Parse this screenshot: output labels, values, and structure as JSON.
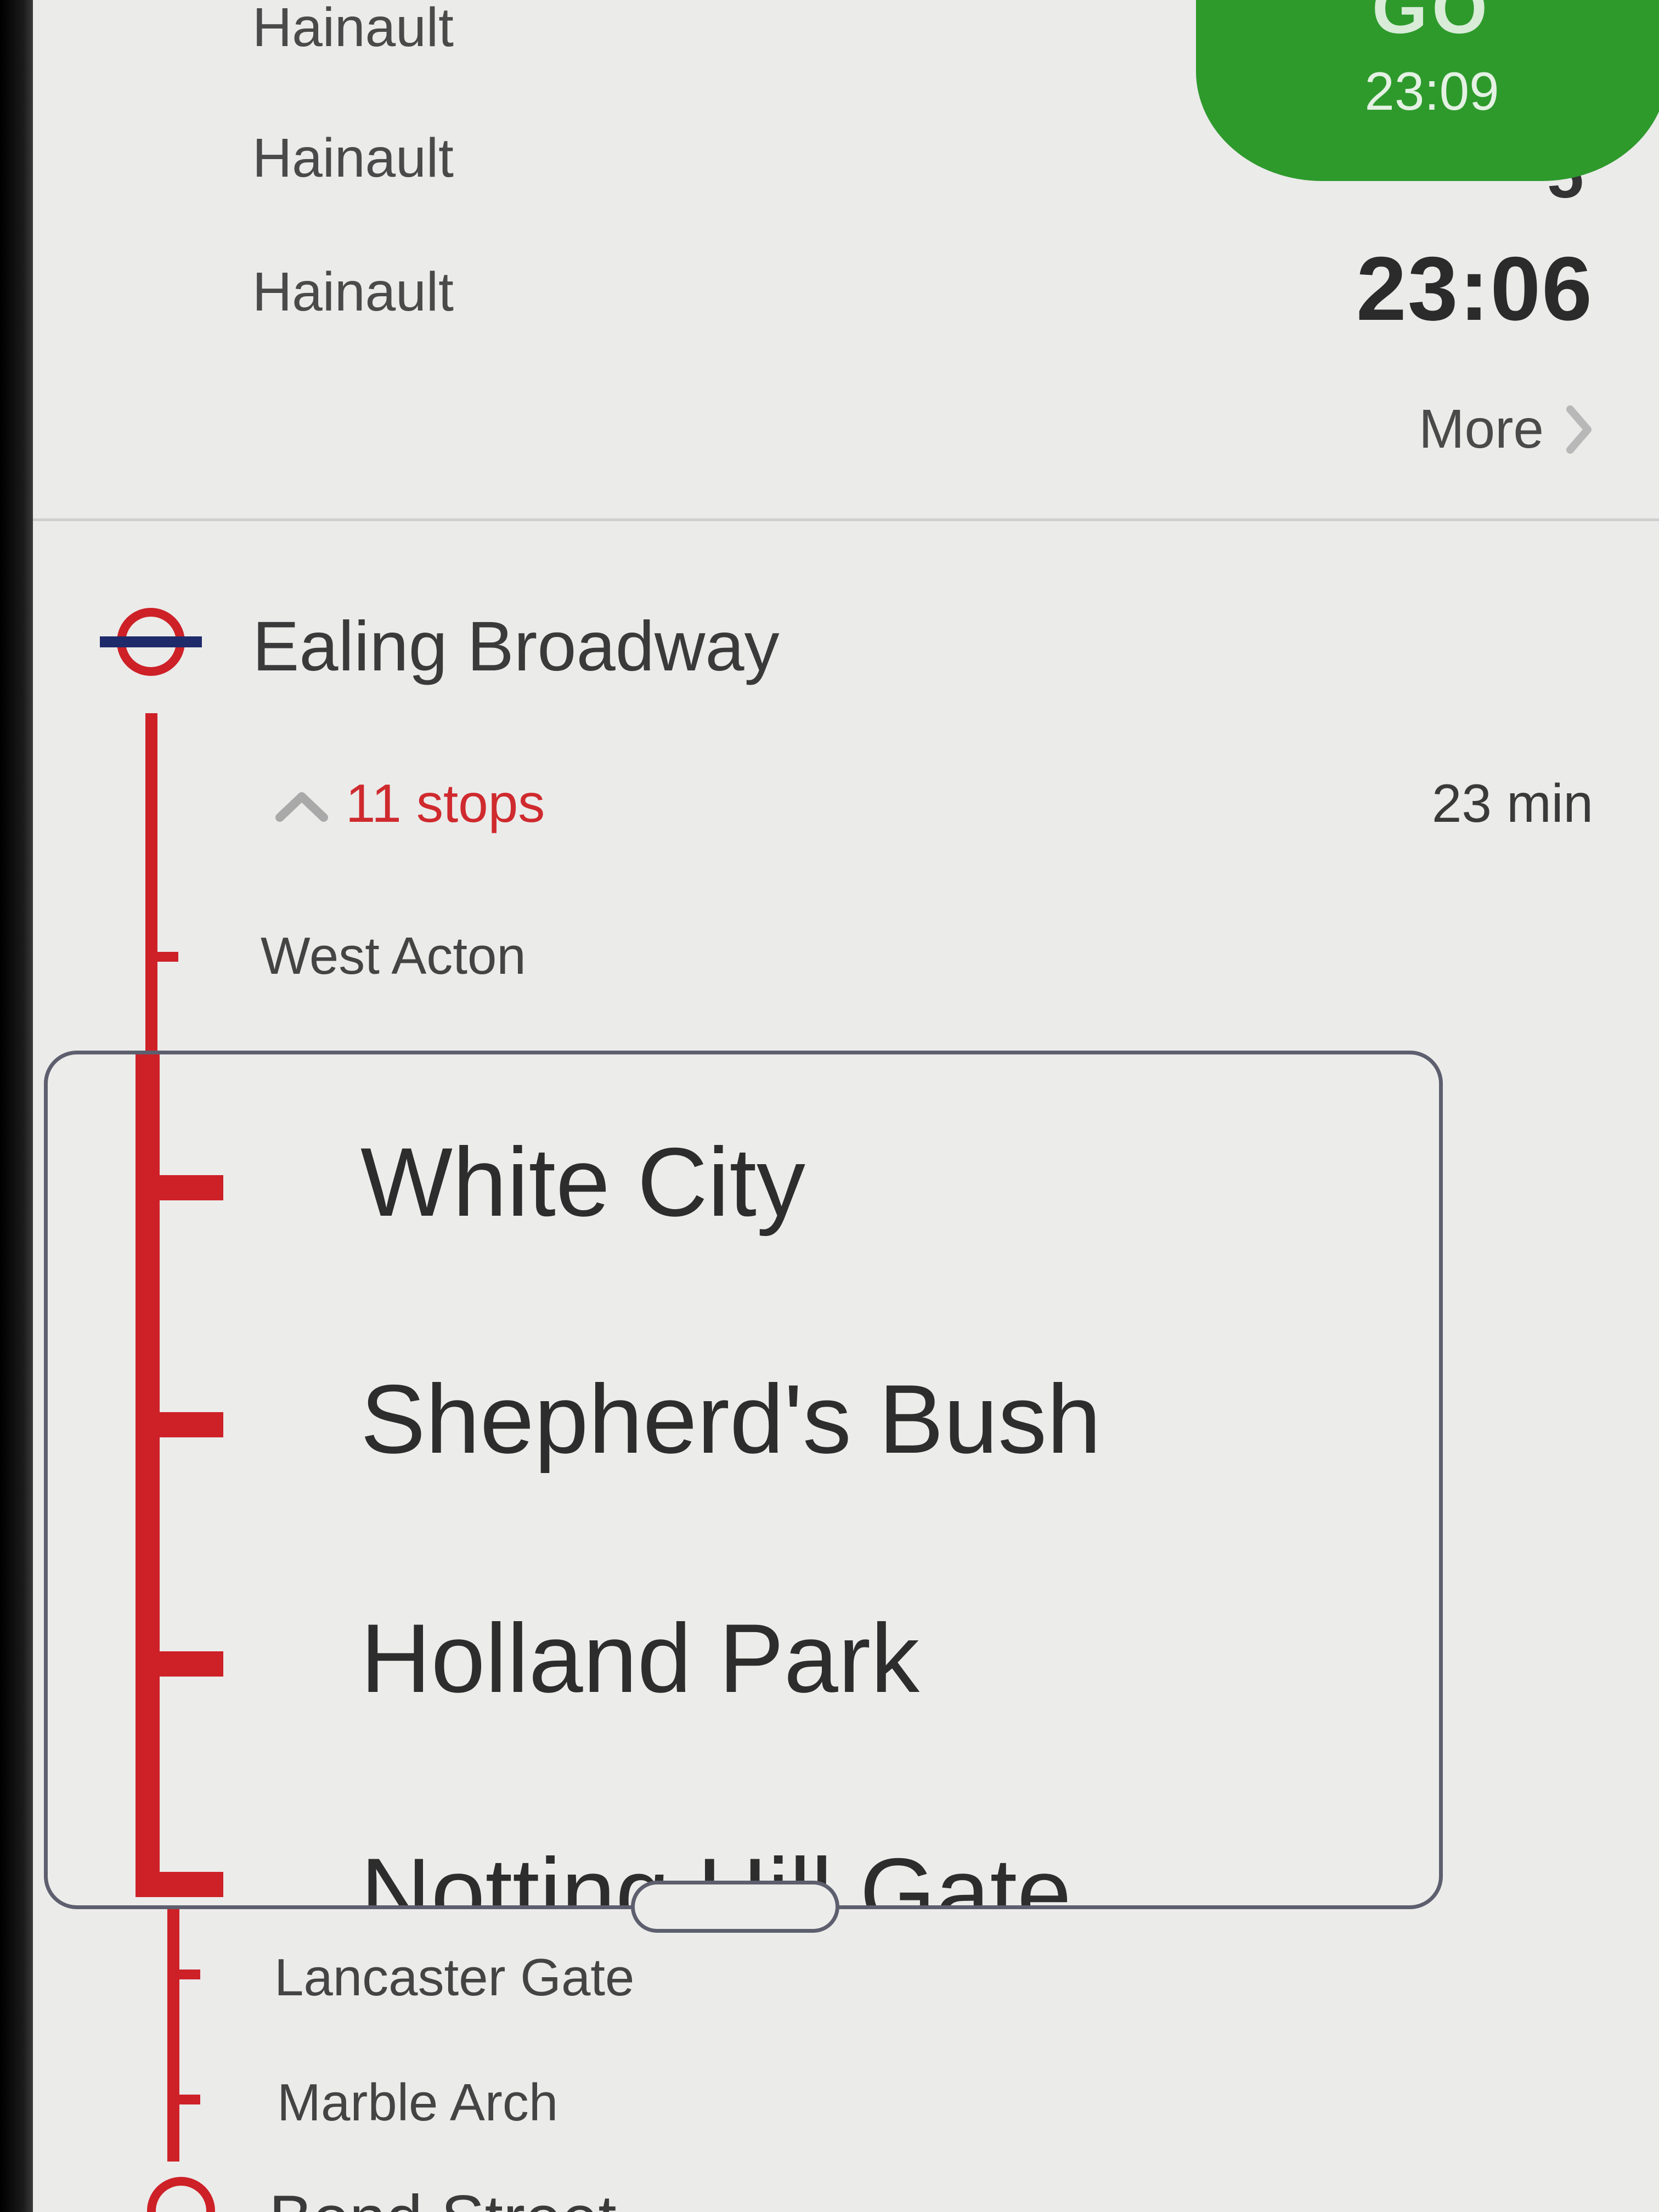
{
  "departures": [
    {
      "destination": "Hainault"
    },
    {
      "destination": "Hainault"
    },
    {
      "destination": "Hainault",
      "time": "23:06"
    }
  ],
  "go_button": {
    "label": "GO",
    "time": "23:09"
  },
  "more_label": "More",
  "leg": {
    "origin": "Ealing Broadway",
    "stops_toggle": "11 stops",
    "duration": "23 min",
    "stops_above": [
      "West Acton"
    ],
    "magnified_stops": [
      "White City",
      "Shepherd's Bush",
      "Holland Park",
      "Notting Hill Gate"
    ],
    "stops_below": [
      "Lancaster Gate",
      "Marble Arch"
    ],
    "next_station": "Bond Street"
  },
  "colors": {
    "line": "#cd2127",
    "go": "#2e9a2c",
    "roundel_bar": "#1f2a6b"
  }
}
